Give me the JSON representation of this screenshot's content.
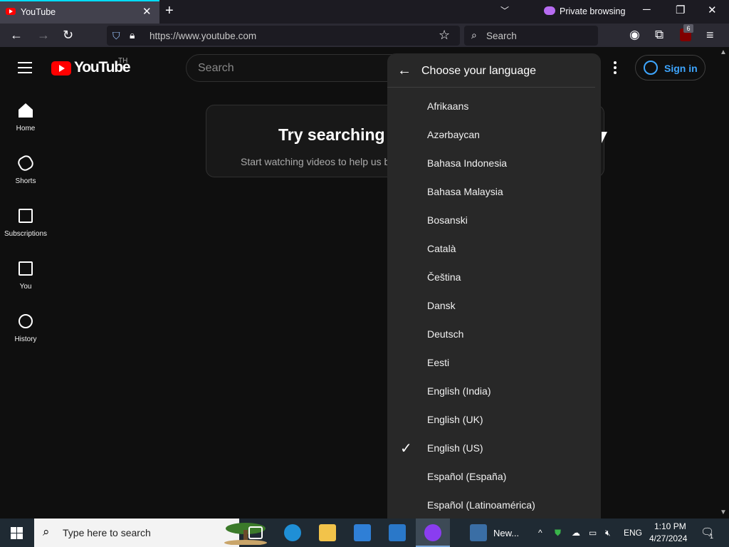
{
  "browser": {
    "tab_title": "YouTube",
    "private_label": "Private browsing",
    "url": "https://www.youtube.com",
    "search_placeholder": "Search",
    "extension_badge": "6"
  },
  "youtube": {
    "logo_text": "YouTube",
    "country_code": "TH",
    "search_placeholder": "Search",
    "signin_label": "Sign in",
    "guide": [
      {
        "label": "Home",
        "icon": "home-icon"
      },
      {
        "label": "Shorts",
        "icon": "shorts-icon"
      },
      {
        "label": "Subscriptions",
        "icon": "subscriptions-icon"
      },
      {
        "label": "You",
        "icon": "you-icon"
      },
      {
        "label": "History",
        "icon": "history-icon"
      }
    ],
    "promo_title": "Try searching t",
    "promo_subtitle": "Start watching videos to help us b",
    "language_menu": {
      "title": "Choose your language",
      "selected": "English (US)",
      "items": [
        "Afrikaans",
        "Azərbaycan",
        "Bahasa Indonesia",
        "Bahasa Malaysia",
        "Bosanski",
        "Català",
        "Čeština",
        "Dansk",
        "Deutsch",
        "Eesti",
        "English (India)",
        "English (UK)",
        "English (US)",
        "Español (España)",
        "Español (Latinoamérica)"
      ]
    }
  },
  "taskbar": {
    "search_placeholder": "Type here to search",
    "news_label": "New...",
    "language": "ENG",
    "time": "1:10 PM",
    "date": "4/27/2024",
    "notification_count": "1"
  },
  "colors": {
    "accent_blue": "#3ea6ff",
    "youtube_red": "#ff0000",
    "menu_bg": "#282828",
    "page_bg": "#0f0f0f"
  }
}
